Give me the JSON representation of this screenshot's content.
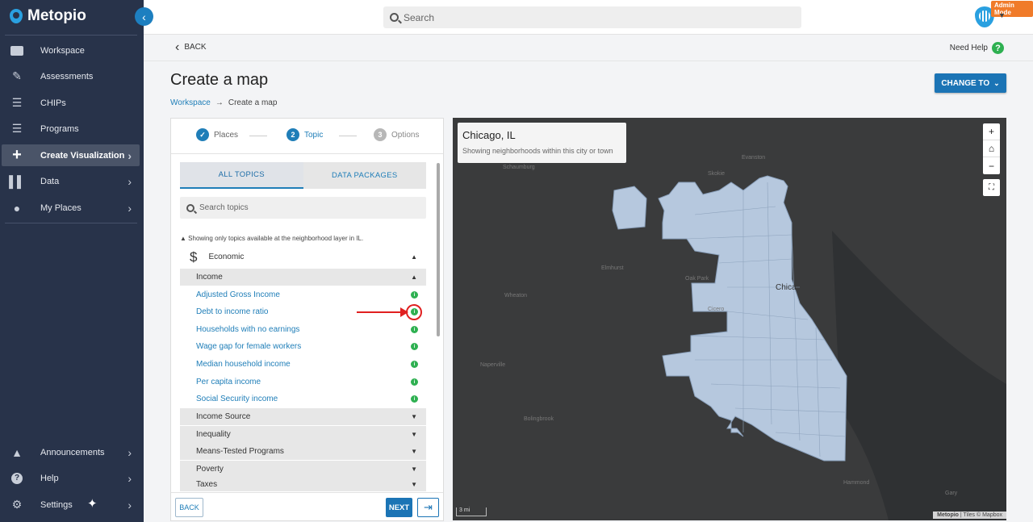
{
  "app": {
    "name": "Metopio",
    "admin_badge": "Admin Mode"
  },
  "sidebar": {
    "items": [
      {
        "label": "Workspace"
      },
      {
        "label": "Assessments"
      },
      {
        "label": "CHIPs"
      },
      {
        "label": "Programs"
      },
      {
        "label": "Create Visualization"
      },
      {
        "label": "Data"
      },
      {
        "label": "My Places"
      }
    ],
    "bottom": [
      {
        "label": "Announcements"
      },
      {
        "label": "Help"
      },
      {
        "label": "Settings"
      }
    ]
  },
  "topbar": {
    "search_placeholder": "Search"
  },
  "subbar": {
    "back_label": "BACK",
    "help_label": "Need Help"
  },
  "page": {
    "title": "Create a map",
    "breadcrumb": {
      "link": "Workspace",
      "current": "Create a map"
    },
    "change_to_label": "CHANGE TO"
  },
  "panel": {
    "steps": [
      {
        "num": "✓",
        "label": "Places",
        "state": "done"
      },
      {
        "num": "2",
        "label": "Topic",
        "state": "active"
      },
      {
        "num": "3",
        "label": "Options",
        "state": "pending"
      }
    ],
    "tabs": {
      "all": "ALL TOPICS",
      "packages": "DATA PACKAGES"
    },
    "search_placeholder": "Search topics",
    "note": "Showing only topics available at the neighborhood layer in IL.",
    "category": {
      "icon": "$",
      "label": "Economic"
    },
    "subcategory": "Income",
    "topics": [
      "Adjusted Gross Income",
      "Debt to income ratio",
      "Households with no earnings",
      "Wage gap for female workers",
      "Median household income",
      "Per capita income",
      "Social Security income"
    ],
    "collapsed_groups": [
      "Income Source",
      "Inequality",
      "Means-Tested Programs",
      "Poverty",
      "Taxes"
    ],
    "back_button": "BACK",
    "next_button": "NEXT"
  },
  "map": {
    "place_name": "Chicago, IL",
    "place_desc": "Showing neighborhoods within this city or town",
    "scale_label": "3 mi",
    "attribution_brand": "Metopio",
    "attribution_text": "| Tiles © Mapbox",
    "labels": [
      "Schaumburg",
      "Evanston",
      "Skokie",
      "Wheaton",
      "Oak Park",
      "Naperville",
      "Bolingbrook",
      "Hammond",
      "Gary",
      "Cicero",
      "Elmhurst",
      "Chica"
    ]
  },
  "colors": {
    "sidebar_bg": "#28334a",
    "accent": "#1b74b5",
    "info_green": "#2eb051",
    "admin_orange": "#f07b2a",
    "highlight_red": "#e02020",
    "map_fill": "#b6c8de"
  }
}
